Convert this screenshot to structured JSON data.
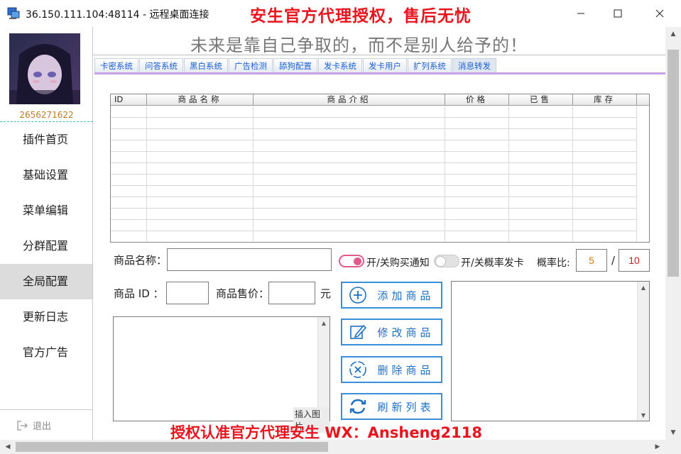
{
  "window": {
    "title": "36.150.111.104:48114 - 远程桌面连接",
    "banner_top": "安生官方代理授权，售后无忧",
    "banner_bottom": "授权认准官方代理安生 WX：Ansheng2118"
  },
  "sidebar": {
    "qq": "2656271622",
    "items": [
      {
        "label": "插件首页"
      },
      {
        "label": "基础设置"
      },
      {
        "label": "菜单编辑"
      },
      {
        "label": "分群配置"
      },
      {
        "label": "全局配置"
      },
      {
        "label": "更新日志"
      },
      {
        "label": "官方广告"
      }
    ],
    "active": "全局配置",
    "exit_label": "退出"
  },
  "header": {
    "slogan": "未来是靠自己争取的，而不是别人给予的！"
  },
  "tabs": [
    {
      "label": "卡密系统"
    },
    {
      "label": "问答系统"
    },
    {
      "label": "黑白系统"
    },
    {
      "label": "广告检测"
    },
    {
      "label": "舔狗配置"
    },
    {
      "label": "发卡系统"
    },
    {
      "label": "发卡用户"
    },
    {
      "label": "扩列系统"
    },
    {
      "label": "消息转发"
    }
  ],
  "table": {
    "columns": [
      "ID",
      "商品名称",
      "商品介绍",
      "价格",
      "已售",
      "库存"
    ],
    "rows": []
  },
  "form": {
    "name_label": "商品名称：",
    "name_value": "",
    "id_label": "商品 ID ：",
    "id_value": "",
    "price_label": "商品售价：",
    "price_value": "",
    "yuan_label": "元",
    "buy_notify_label": "开/关购买通知",
    "buy_notify_on": true,
    "rate_card_label": "开/关概率发卡",
    "rate_card_on": false,
    "ratio_label": "概率比:",
    "ratio_numerator": "5",
    "ratio_slash": "/",
    "ratio_denominator": "10",
    "insert_image_label": "插入图片"
  },
  "actions": {
    "add": "添加商品",
    "edit": "修改商品",
    "delete": "删除商品",
    "refresh": "刷新列表"
  },
  "colors": {
    "accent_red": "#e8141e",
    "button_blue": "#3a8fd8",
    "tab_strip": "#c8a1e6",
    "toggle_on": "#e05b8a"
  }
}
